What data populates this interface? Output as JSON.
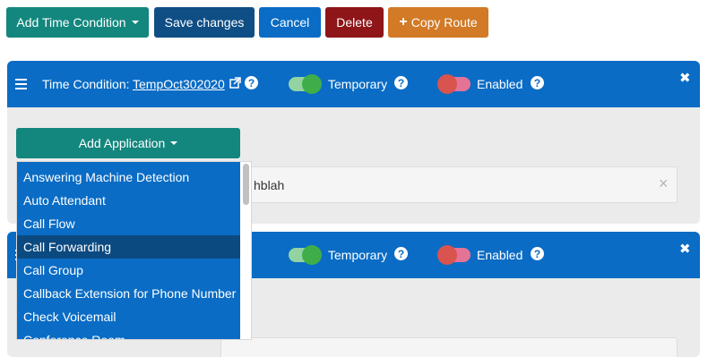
{
  "toolbar": {
    "add_time_condition": "Add Time Condition",
    "save_changes": "Save changes",
    "cancel": "Cancel",
    "delete": "Delete",
    "copy_route": "Copy Route",
    "copy_route_icon": "+"
  },
  "panel1": {
    "title_prefix": "Time Condition:",
    "title_link": "TempOct302020",
    "temporary_label": "Temporary",
    "enabled_label": "Enabled",
    "close": "✖",
    "field_value_partial": "hblah",
    "field_clear": "×"
  },
  "panel2": {
    "temporary_label": "Temporary",
    "enabled_label": "Enabled",
    "close": "✖"
  },
  "add_application": {
    "label": "Add Application",
    "options": [
      "Answering Machine Detection",
      "Auto Attendant",
      "Call Flow",
      "Call Forwarding",
      "Call Group",
      "Callback Extension for Phone Number",
      "Check Voicemail",
      "Conference Room"
    ],
    "highlighted": "Call Forwarding"
  },
  "colors": {
    "teal": "#13877e",
    "navy": "#0f4e85",
    "blue": "#0a6cc5",
    "red": "#8e1518",
    "orange": "#d27a26",
    "highlight": "#0b4a80"
  },
  "icons": {
    "menu": "hamburger-icon",
    "external_link": "external-link-icon",
    "help": "question-circle-icon",
    "close": "close-icon",
    "plus": "plus-icon"
  }
}
